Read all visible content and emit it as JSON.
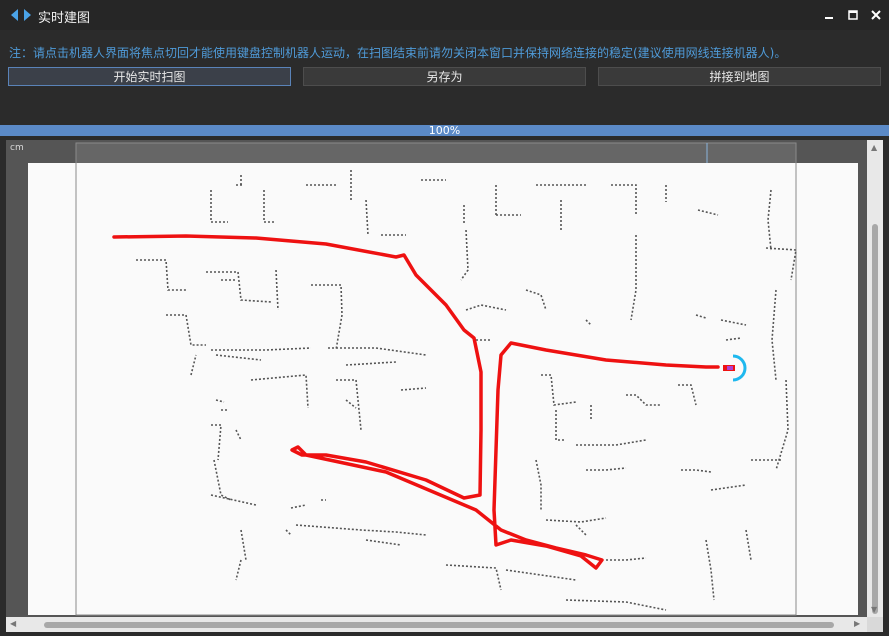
{
  "window": {
    "title": "实时建图",
    "icons": {
      "app": "code-arrows-icon",
      "minimize": "minimize-icon",
      "maximize": "maximize-icon",
      "close": "close-icon"
    }
  },
  "toolbar": {
    "notice": "注：请点击机器人界面将焦点切回才能使用键盘控制机器人运动，在扫图结束前请勿关闭本窗口并保持网络连接的稳定(建议使用网线连接机器人)。",
    "start_label": "开始实时扫图",
    "save_as_label": "另存为",
    "merge_label": "拼接到地图"
  },
  "progress": {
    "value": 1.0,
    "label": "100%"
  },
  "map": {
    "unit_label": "cm"
  },
  "colors": {
    "accent": "#5b8ac7",
    "notice_text": "#4f9bd9",
    "path": "#ee1111",
    "robot_ring": "#1eb8ee",
    "map_background": "#fafafa"
  }
}
